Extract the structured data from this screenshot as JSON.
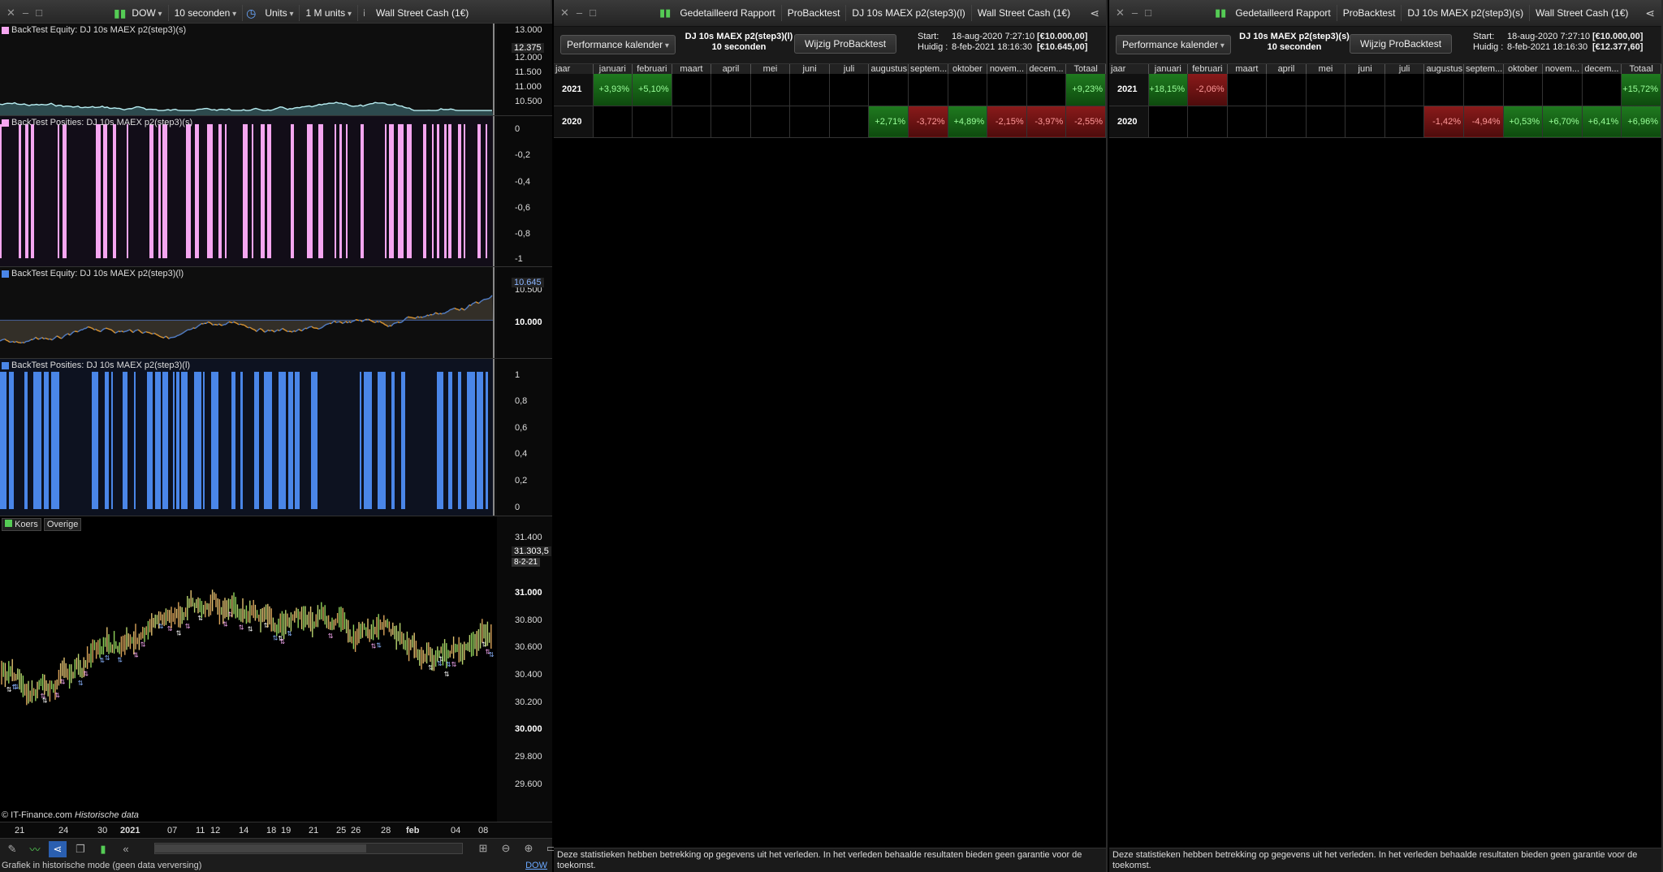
{
  "left": {
    "toolbar": {
      "instrument": "DOW",
      "interval": "10 seconden",
      "units": "Units",
      "size": "1 M units",
      "market": "Wall Street Cash (1€)"
    },
    "panes": {
      "equity_short": {
        "label": "BackTest Equity: DJ 10s MAEX p2(step3)(s)",
        "yticks": [
          "13.000",
          "12.500",
          "12.000",
          "11.500",
          "11.000",
          "10.500"
        ],
        "current": "12.375",
        "color": "#b8eef2"
      },
      "positions_short": {
        "label": "BackTest Posities: DJ 10s MAEX p2(step3)(s)",
        "yticks": [
          "0",
          "-0,2",
          "-0,4",
          "-0,6",
          "-0,8",
          "-1"
        ],
        "color": "#f5a6f0"
      },
      "equity_long": {
        "label": "BackTest Equity: DJ 10s MAEX p2(step3)(l)",
        "yticks": [
          "10.500",
          "10.000"
        ],
        "current": "10.645",
        "color_up": "#4a7fd6",
        "color_down": "#e89a2c"
      },
      "positions_long": {
        "label": "BackTest Posities: DJ 10s MAEX p2(step3)(l)",
        "yticks": [
          "1",
          "0,8",
          "0,6",
          "0,4",
          "0,2",
          "0"
        ],
        "color": "#4a86e8"
      },
      "price": {
        "label": "Koers",
        "tab2": "Overige",
        "yticks": [
          "31.400",
          "31.000",
          "30.800",
          "30.600",
          "30.400",
          "30.200",
          "30.000",
          "29.800",
          "29.600"
        ],
        "current": "31.303,5",
        "date_tag": "8-2-21",
        "copyright": "© IT-Finance.com",
        "mode": "Historische data"
      }
    },
    "xaxis": [
      "21",
      "24",
      "30",
      "2021",
      "07",
      "11",
      "12",
      "14",
      "18",
      "19",
      "21",
      "25",
      "26",
      "28",
      "feb",
      "04",
      "08"
    ],
    "status": "Grafiek in historische mode (geen data verversing)",
    "status_link": "DOW"
  },
  "reports": [
    {
      "tabs": [
        "Gedetailleerd Rapport",
        "ProBacktest",
        "DJ 10s MAEX p2(step3)(l)",
        "Wall Street Cash (1€)"
      ],
      "perf_button": "Performance kalender",
      "bt_name": "DJ 10s MAEX p2(step3)(l)",
      "bt_interval": "10 seconden",
      "wijzig": "Wijzig ProBacktest",
      "start_label": "Start:",
      "start_date": "18-aug-2020 7:27:10",
      "start_val": "[€10.000,00]",
      "now_label": "Huidig :",
      "now_date": "8-feb-2021 18:16:30",
      "now_val": "[€10.645,00]",
      "headers": [
        "jaar",
        "januari",
        "februari",
        "maart",
        "april",
        "mei",
        "juni",
        "juli",
        "augustus",
        "septem...",
        "oktober",
        "novem...",
        "decem...",
        "Totaal"
      ],
      "rows": [
        {
          "year": "2021",
          "cells": [
            "+3,93%",
            "+5,10%",
            "",
            "",
            "",
            "",
            "",
            "",
            "",
            "",
            "",
            "",
            "+9,23%"
          ]
        },
        {
          "year": "2020",
          "cells": [
            "",
            "",
            "",
            "",
            "",
            "",
            "",
            "+2,71%",
            "-3,72%",
            "+4,89%",
            "-2,15%",
            "-3,97%",
            "-2,55%"
          ]
        }
      ],
      "footer": "Deze statistieken hebben betrekking op gegevens uit het verleden. In het verleden behaalde resultaten bieden geen garantie voor de toekomst."
    },
    {
      "tabs": [
        "Gedetailleerd Rapport",
        "ProBacktest",
        "DJ 10s MAEX p2(step3)(s)",
        "Wall Street Cash (1€)"
      ],
      "perf_button": "Performance kalender",
      "bt_name": "DJ 10s MAEX p2(step3)(s)",
      "bt_interval": "10 seconden",
      "wijzig": "Wijzig ProBacktest",
      "start_label": "Start:",
      "start_date": "18-aug-2020 7:27:10",
      "start_val": "[€10.000,00]",
      "now_label": "Huidig :",
      "now_date": "8-feb-2021 18:16:30",
      "now_val": "[€12.377,60]",
      "headers": [
        "jaar",
        "januari",
        "februari",
        "maart",
        "april",
        "mei",
        "juni",
        "juli",
        "augustus",
        "septem...",
        "oktober",
        "novem...",
        "decem...",
        "Totaal"
      ],
      "rows": [
        {
          "year": "2021",
          "cells": [
            "+18,15%",
            "-2,06%",
            "",
            "",
            "",
            "",
            "",
            "",
            "",
            "",
            "",
            "",
            "+15,72%"
          ]
        },
        {
          "year": "2020",
          "cells": [
            "",
            "",
            "",
            "",
            "",
            "",
            "",
            "-1,42%",
            "-4,94%",
            "+0,53%",
            "+6,70%",
            "+6,41%",
            "+6,96%"
          ]
        }
      ],
      "footer": "Deze statistieken hebben betrekking op gegevens uit het verleden. In het verleden behaalde resultaten bieden geen garantie voor de toekomst."
    }
  ]
}
